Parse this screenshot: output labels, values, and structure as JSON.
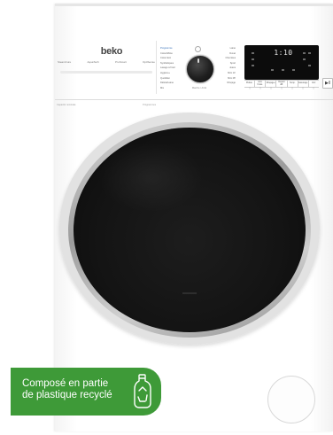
{
  "product": {
    "brand": "beko",
    "feature_badges": [
      "SteamCure",
      "AquaTech",
      "ProSmart",
      "OptiSense"
    ],
    "sub_labels": [
      "Capacité nominale",
      "Programmes"
    ]
  },
  "control_panel": {
    "programs_left": [
      "Programme",
      "Coton/Mixte",
      "Coton Eco",
      "Synthétiques",
      "Lavage à froid",
      "Hygiène+",
      "Quotidien",
      "Délicat/Laine",
      "Mix",
      "Essorage"
    ],
    "programs_right": [
      "Laine",
      "Duvet",
      "Chemises",
      "Sport",
      "Jeans",
      "Mini 14'",
      "Mini 28'",
      "Rinçage",
      "Vidange"
    ],
    "dial_label": "Marche / Arrêt",
    "display_digits": "1:10",
    "buttons": [
      "Prélav.",
      "Anti-froiss.",
      "Rinçage+",
      "Départ diff.",
      "Temp.",
      "Essorage",
      "Verr."
    ],
    "button_marks": [
      "▢",
      "▢",
      "▢",
      "▢",
      "▢",
      "▢",
      "▢"
    ],
    "play_icon": "play-pause-icon"
  },
  "badge": {
    "line1": "Composé en partie",
    "line2": "de plastique recyclé",
    "color": "#3e9a38",
    "icon": "recycled-bottle-icon"
  }
}
